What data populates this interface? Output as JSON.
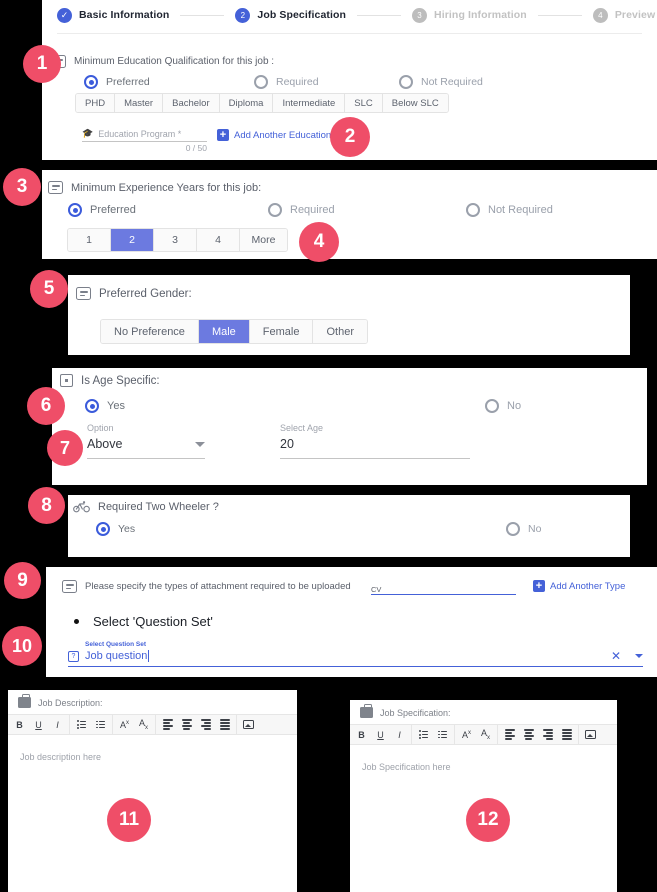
{
  "stepper": {
    "steps": [
      {
        "num": "1",
        "label": "Basic Information",
        "state": "done"
      },
      {
        "num": "2",
        "label": "Job Specification",
        "state": "active"
      },
      {
        "num": "3",
        "label": "Hiring Information",
        "state": "todo"
      },
      {
        "num": "4",
        "label": "Preview and Complete",
        "state": "todo"
      }
    ]
  },
  "education": {
    "title": "Minimum Education Qualification for this job :",
    "icon": "form-icon",
    "options": [
      {
        "label": "Preferred",
        "selected": true
      },
      {
        "label": "Required",
        "selected": false
      },
      {
        "label": "Not Required",
        "selected": false
      }
    ],
    "levels": [
      "PHD",
      "Master",
      "Bachelor",
      "Diploma",
      "Intermediate",
      "SLC",
      "Below SLC"
    ],
    "program_field": {
      "icon": "education-icon",
      "placeholder": "Education Program *",
      "value": "",
      "counter": "0 / 50"
    },
    "add_link": "Add Another Education"
  },
  "experience": {
    "title": "Minimum Experience Years for this job:",
    "icon": "form-icon",
    "options": [
      {
        "label": "Preferred",
        "selected": true
      },
      {
        "label": "Required",
        "selected": false
      },
      {
        "label": "Not Required",
        "selected": false
      }
    ],
    "years": [
      "1",
      "2",
      "3",
      "4",
      "More"
    ],
    "selected_year": "2"
  },
  "gender": {
    "title": "Preferred Gender:",
    "icon": "form-icon",
    "options": [
      "No Preference",
      "Male",
      "Female",
      "Other"
    ],
    "selected": "Male"
  },
  "age": {
    "title": "Is Age Specific:",
    "icon": "calendar-icon",
    "options": [
      {
        "label": "Yes",
        "selected": true
      },
      {
        "label": "No",
        "selected": false
      }
    ],
    "option_field": {
      "label": "Option",
      "value": "Above"
    },
    "age_field": {
      "label": "Select Age",
      "value": "20"
    }
  },
  "two_wheeler": {
    "title": "Required Two Wheeler ?",
    "icon": "bicycle-icon",
    "options": [
      {
        "label": "Yes",
        "selected": true
      },
      {
        "label": "No",
        "selected": false
      }
    ]
  },
  "attachment": {
    "title": "Please specify the types of attachment required to be uploaded",
    "icon": "form-icon",
    "type_field": {
      "value": "CV"
    },
    "add_link": "Add Another Type",
    "bullet": "Select 'Question Set'",
    "question_set": {
      "icon": "calendar-question-icon",
      "label": "Select Question Set",
      "value": "Job question",
      "clear_icon": "close-icon",
      "dropdown_icon": "chevron-down-icon"
    }
  },
  "job_description": {
    "title": "Job Description:",
    "icon": "briefcase-icon",
    "placeholder": "Job description here",
    "toolbar": [
      "B",
      "U",
      "I",
      "bulleted-list",
      "numbered-list",
      "superscript",
      "subscript",
      "align-left",
      "align-center",
      "align-right",
      "align-justify",
      "insert-image"
    ]
  },
  "job_specification": {
    "title": "Job Specification:",
    "icon": "briefcase-icon",
    "placeholder": "Job Specification here",
    "toolbar": [
      "B",
      "U",
      "I",
      "bulleted-list",
      "numbered-list",
      "superscript",
      "subscript",
      "align-left",
      "align-center",
      "align-right",
      "align-justify",
      "insert-image"
    ]
  },
  "badges": [
    {
      "num": "1"
    },
    {
      "num": "2"
    },
    {
      "num": "3"
    },
    {
      "num": "4"
    },
    {
      "num": "5"
    },
    {
      "num": "6"
    },
    {
      "num": "7"
    },
    {
      "num": "8"
    },
    {
      "num": "9"
    },
    {
      "num": "10"
    },
    {
      "num": "11"
    },
    {
      "num": "12"
    }
  ],
  "colors": {
    "accent": "#4461d8",
    "selected_chip": "#6c7ae0",
    "badge": "#ef4e68"
  }
}
